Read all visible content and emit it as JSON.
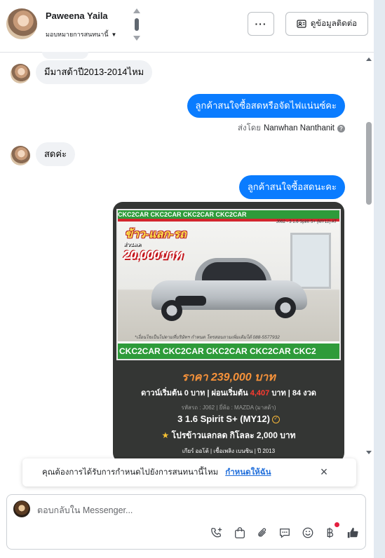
{
  "header": {
    "contact_name": "Paweena Yaila",
    "assign_label": "มอบหมายการสนทนานี้",
    "more_label": "···",
    "contact_info_button": "ดูข้อมูลติดต่อ"
  },
  "messages": [
    {
      "direction": "in",
      "text": "มีมาสด้าปี2013-2014ไหม"
    },
    {
      "direction": "out",
      "text": "ลูกค้าสนใจซื้อสดหรือจัดไฟแน่นซ์คะ"
    },
    {
      "direction": "in",
      "text": "สดค่ะ"
    },
    {
      "direction": "out",
      "text": "ลูกค้าสนใจซื้อสดนะคะ"
    }
  ],
  "sent_by": {
    "prefix": "ส่งโดย",
    "name": "Nanwhan Nanthanit"
  },
  "listing": {
    "top_band": "CKC2CAR CKC2CAR CKC2CAR CKC2CAR",
    "tag": "J062 - 3 1.6 Spirit S+ (MY12) AT",
    "promo_line1": "ข้าว-แลก-รถ",
    "promo_line2": "ส่วนลด",
    "promo_line3": "20,000บาท",
    "photo_note": "*เงื่อนไขเป็นไปตามที่บริษัทฯ กำหนด โทรสอบถามเพิ่มเติมได้ 088-5577932",
    "bottom_band": "CKC2CAR CKC2CAR CKC2CAR CKC2CAR CKC2",
    "price": "ราคา 239,000 บาท",
    "terms_a": "ดาวน์เริ่มต้น 0 บาท | ผ่อนเริ่มต้น",
    "terms_red": "4,407",
    "terms_b": "บาท | 84 งวด",
    "spec": "รหัสรถ : J062 | ยี่ห้อ : MAZDA (มาสด้า)",
    "model": "3 1.6 Spirit S+ (MY12)",
    "promo": "โปรข้าวแลกลด กิโลละ 2,000 บาท",
    "meta": "เกียร์ ออโต้   |   เชื้อเพลิง เบนซิน   |   ปี 2013"
  },
  "notice": {
    "text": "คุณต้องการได้รับการกำหนดไปยังการสนทนานี้ไหม",
    "link": "กำหนดให้ฉัน",
    "close": "×"
  },
  "composer": {
    "placeholder": "ตอบกลับใน Messenger..."
  },
  "colors": {
    "outgoing_bubble": "#0a7cff",
    "incoming_bubble": "#f0f2f5",
    "link": "#216fdb",
    "price": "#f6923a"
  },
  "icons": [
    "chevron-up-icon",
    "chevron-down-icon",
    "contact-card-icon",
    "help-icon",
    "close-icon",
    "phone-add-icon",
    "shopping-bag-icon",
    "paperclip-icon",
    "quick-reply-icon",
    "emoji-icon",
    "baht-icon",
    "thumbs-up-icon"
  ]
}
